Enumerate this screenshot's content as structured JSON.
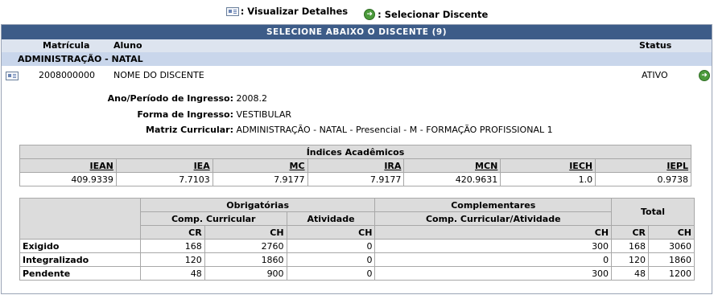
{
  "legend": {
    "details_label": ": Visualizar Detalhes",
    "select_label": ": Selecionar Discente"
  },
  "panel": {
    "caption": "SELECIONE ABAIXO O DISCENTE (9)",
    "col_matricula": "Matrícula",
    "col_aluno": "Aluno",
    "col_status": "Status",
    "group": "ADMINISTRAÇÃO - NATAL"
  },
  "student": {
    "matricula": "2008000000",
    "nome": "NOME DO DISCENTE",
    "status": "ATIVO",
    "ingresso_label": "Ano/Período de Ingresso:",
    "ingresso": "2008.2",
    "forma_label": "Forma de Ingresso:",
    "forma": "VESTIBULAR",
    "matriz_label": "Matriz Curricular:",
    "matriz": "ADMINISTRAÇÃO - NATAL - Presencial - M - FORMAÇÃO PROFISSIONAL 1"
  },
  "indices": {
    "title": "Índices Acadêmicos",
    "headers": [
      "IEAN",
      "IEA",
      "MC",
      "IRA",
      "MCN",
      "IECH",
      "IEPL"
    ],
    "values": [
      "409.9339",
      "7.7103",
      "7.9177",
      "7.9177",
      "420.9631",
      "1.0",
      "0.9738"
    ]
  },
  "workload": {
    "obrigatorias": "Obrigatórias",
    "complementares": "Complementares",
    "total": "Total",
    "comp_curricular": "Comp. Curricular",
    "atividade": "Atividade",
    "comp_curr_atividade": "Comp. Curricular/Atividade",
    "cr": "CR",
    "ch": "CH",
    "rows": [
      {
        "label": "Exigido",
        "cr": "168",
        "ch": "2760",
        "at_ch": "0",
        "comp_ch": "300",
        "tot_cr": "168",
        "tot_ch": "3060"
      },
      {
        "label": "Integralizado",
        "cr": "120",
        "ch": "1860",
        "at_ch": "0",
        "comp_ch": "0",
        "tot_cr": "120",
        "tot_ch": "1860"
      },
      {
        "label": "Pendente",
        "cr": "48",
        "ch": "900",
        "at_ch": "0",
        "comp_ch": "300",
        "tot_cr": "48",
        "tot_ch": "1200"
      }
    ]
  }
}
